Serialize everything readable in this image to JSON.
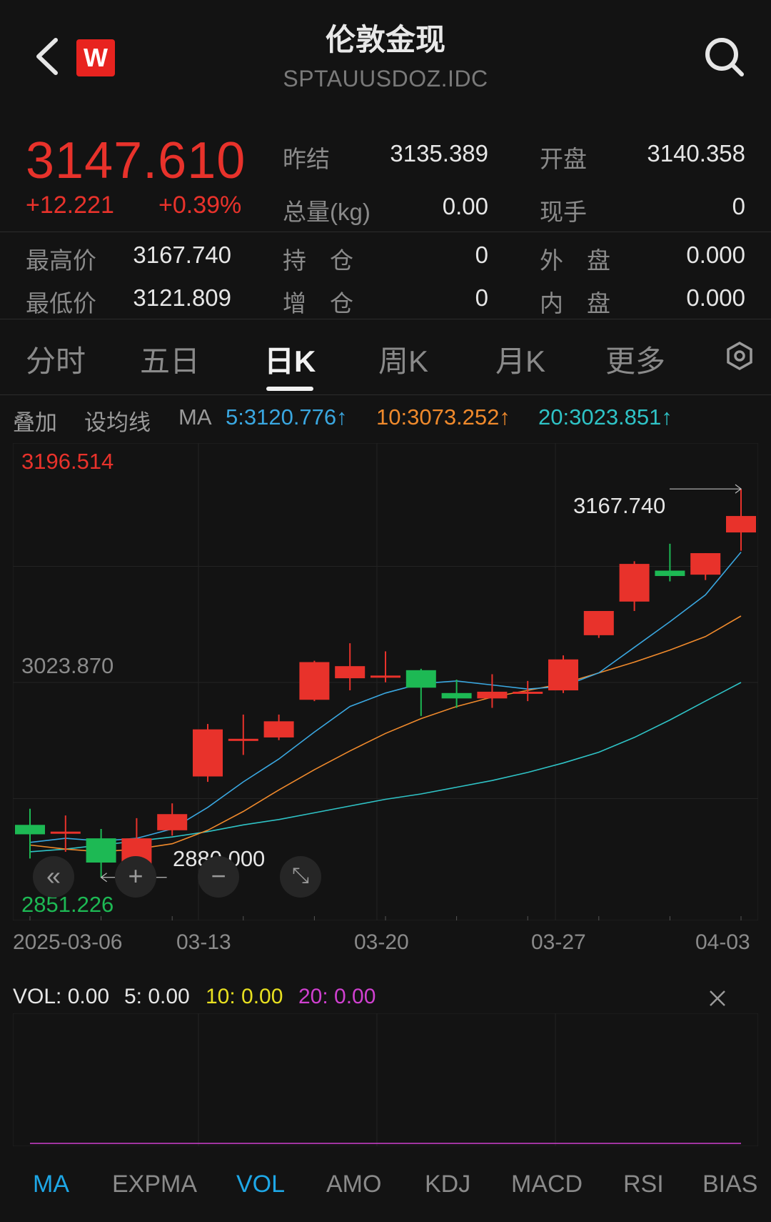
{
  "header": {
    "title": "伦敦金现",
    "subtitle": "SPTAUUSDOZ.IDC",
    "logo_letter": "W"
  },
  "quote": {
    "price": "3147.610",
    "change": "+12.221",
    "change_pct": "+0.39%",
    "prev_settle_label": "昨结",
    "prev_settle": "3135.389",
    "open_label": "开盘",
    "open": "3140.358",
    "volume_label": "总量(kg)",
    "volume": "0.00",
    "last_hand_label": "现手",
    "last_hand": "0",
    "high_label": "最高价",
    "high": "3167.740",
    "position_label": "持　仓",
    "position": "0",
    "outer_label": "外　盘",
    "outer": "0.000",
    "low_label": "最低价",
    "low": "3121.809",
    "increase_label": "增　仓",
    "increase": "0",
    "inner_label": "内　盘",
    "inner": "0.000"
  },
  "tabs": [
    "分时",
    "五日",
    "日K",
    "周K",
    "月K",
    "更多"
  ],
  "active_tab": "日K",
  "ma_row": {
    "overlay": "叠加",
    "set_ma": "设均线",
    "ma": "MA",
    "ma5": "5:3120.776↑",
    "ma10": "10:3073.252↑",
    "ma20": "20:3023.851↑"
  },
  "colors": {
    "up": "#e8322b",
    "down": "#1db954",
    "ma5": "#3aa7e0",
    "ma10": "#f08a2c",
    "ma20": "#2fc3c6",
    "vol10": "#e8e020",
    "vol20": "#d040d0",
    "accent": "#1ea7e6"
  },
  "chart_labels": {
    "y_top": "3196.514",
    "y_mid": "3023.870",
    "y_bottom": "2851.226",
    "high_marker": "3167.740",
    "low_marker": "2880.000"
  },
  "chart_data": {
    "type": "candlestick",
    "ylim": [
      2851.226,
      3196.514
    ],
    "x_tick_labels": [
      "2025-03-06",
      "03-13",
      "03-20",
      "03-27",
      "04-03"
    ],
    "candles": [
      {
        "o": 2918,
        "h": 2930,
        "l": 2893,
        "c": 2911
      },
      {
        "o": 2913,
        "h": 2925,
        "l": 2898,
        "c": 2913
      },
      {
        "o": 2908,
        "h": 2915,
        "l": 2879,
        "c": 2890
      },
      {
        "o": 2888,
        "h": 2923,
        "l": 2880,
        "c": 2908
      },
      {
        "o": 2914,
        "h": 2934,
        "l": 2910,
        "c": 2926
      },
      {
        "o": 2954,
        "h": 2993,
        "l": 2950,
        "c": 2989
      },
      {
        "o": 2982,
        "h": 3000,
        "l": 2970,
        "c": 2982
      },
      {
        "o": 2983,
        "h": 3000,
        "l": 2981,
        "c": 2995
      },
      {
        "o": 3011,
        "h": 3040,
        "l": 3010,
        "c": 3039
      },
      {
        "o": 3027,
        "h": 3053,
        "l": 3018,
        "c": 3036
      },
      {
        "o": 3029,
        "h": 3047,
        "l": 3024,
        "c": 3029
      },
      {
        "o": 3033,
        "h": 3034,
        "l": 2999,
        "c": 3020
      },
      {
        "o": 3016,
        "h": 3026,
        "l": 3005,
        "c": 3012
      },
      {
        "o": 3012,
        "h": 3030,
        "l": 3005,
        "c": 3017
      },
      {
        "o": 3017,
        "h": 3025,
        "l": 3010,
        "c": 3017
      },
      {
        "o": 3018,
        "h": 3044,
        "l": 3016,
        "c": 3041
      },
      {
        "o": 3059,
        "h": 3076,
        "l": 3057,
        "c": 3077
      },
      {
        "o": 3084,
        "h": 3114,
        "l": 3077,
        "c": 3112
      },
      {
        "o": 3107,
        "h": 3127,
        "l": 3099,
        "c": 3103
      },
      {
        "o": 3104,
        "h": 3120,
        "l": 3100,
        "c": 3120
      },
      {
        "o": 3135.389,
        "h": 3167.74,
        "l": 3121.809,
        "c": 3147.61
      }
    ],
    "ma5": [
      2905,
      2908,
      2906,
      2908,
      2915,
      2931,
      2950,
      2967,
      2987,
      3006,
      3016,
      3023,
      3025,
      3022,
      3019,
      3021,
      3031,
      3050,
      3069,
      3089,
      3120.776
    ],
    "ma10": [
      2903,
      2900,
      2898,
      2900,
      2904,
      2914,
      2928,
      2944,
      2959,
      2973,
      2986,
      2997,
      3006,
      3013,
      3018,
      3023,
      3031,
      3039,
      3048,
      3058,
      3073.252
    ],
    "ma20": [
      2898,
      2900,
      2903,
      2906,
      2909,
      2913,
      2918,
      2922,
      2927,
      2932,
      2937,
      2941,
      2946,
      2951,
      2957,
      2964,
      2972,
      2983,
      2996,
      3010,
      3023.851
    ]
  },
  "volume": {
    "vol": "VOL: 0.00",
    "v5": "5: 0.00",
    "v10": "10: 0.00",
    "v20": "20: 0.00"
  },
  "bottom_tabs": [
    "MA",
    "EXPMA",
    "VOL",
    "AMO",
    "KDJ",
    "MACD",
    "RSI",
    "BIAS"
  ],
  "bottom_tabs_active": [
    "MA",
    "VOL"
  ]
}
